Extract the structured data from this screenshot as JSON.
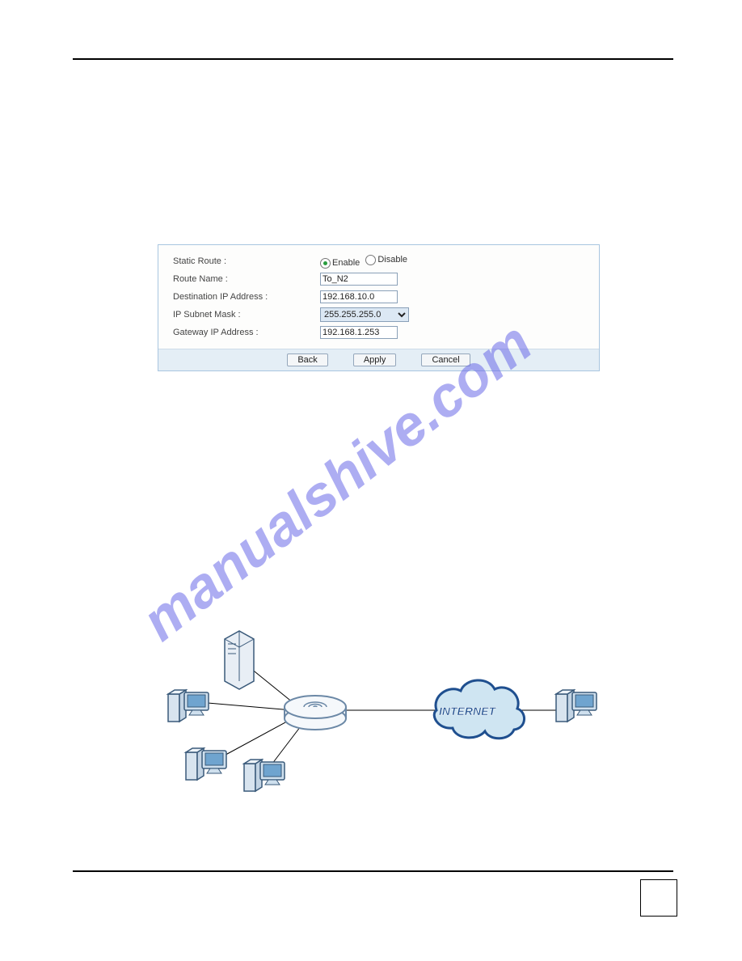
{
  "form": {
    "rows": {
      "static_route": {
        "label": "Static Route :",
        "enable": "Enable",
        "disable": "Disable",
        "selected": "enable"
      },
      "route_name": {
        "label": "Route Name :",
        "value": "To_N2"
      },
      "dest_ip": {
        "label": "Destination IP Address :",
        "value": "192.168.10.0"
      },
      "subnet": {
        "label": "IP Subnet Mask :",
        "value": "255.255.255.0"
      },
      "gateway": {
        "label": "Gateway IP Address :",
        "value": "192.168.1.253"
      }
    },
    "buttons": {
      "back": "Back",
      "apply": "Apply",
      "cancel": "Cancel"
    }
  },
  "diagram": {
    "cloud_label": "INTERNET"
  },
  "watermark": "manualshive.com"
}
